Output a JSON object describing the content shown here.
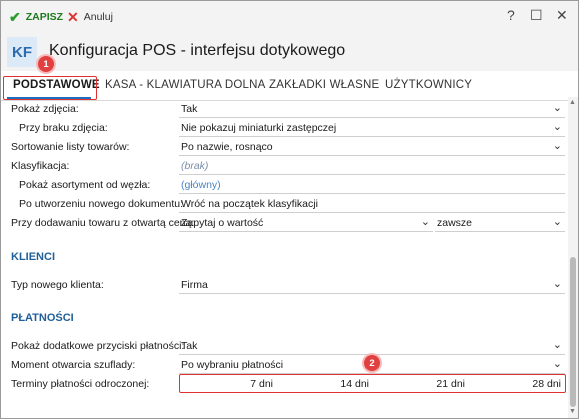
{
  "toolbar": {
    "save": "ZAPISZ",
    "cancel": "Anuluj"
  },
  "window_controls": {
    "help": "?",
    "minimize": "—",
    "maximize": "☐",
    "close": "✕"
  },
  "header": {
    "badge": "KF",
    "title": "Konfiguracja POS - interfejsu dotykowego"
  },
  "tabs": [
    {
      "label": "PODSTAWOWE",
      "active": true
    },
    {
      "label": "KASA - KLAWIATURA DOLNA"
    },
    {
      "label": "ZAKŁADKI WŁASNE"
    },
    {
      "label": "UŻYTKOWNICY"
    }
  ],
  "markers": {
    "m1": "1",
    "m2": "2"
  },
  "general": {
    "pokaz_zdjecia": {
      "label": "Pokaż zdjęcia:",
      "value": "Tak"
    },
    "przy_braku": {
      "label": "Przy braku zdjęcia:",
      "value": "Nie pokazuj miniaturki zastępczej"
    },
    "sortowanie": {
      "label": "Sortowanie listy towarów:",
      "value": "Po nazwie, rosnąco"
    },
    "klasyfikacja": {
      "label": "Klasyfikacja:",
      "value": "(brak)"
    },
    "pokaz_asort": {
      "label": "Pokaż asortyment od węzła:",
      "value": "(główny)"
    },
    "po_utworzeniu": {
      "label": "Po utworzeniu nowego dokumentu:",
      "value": "Wróć na początek klasyfikacji"
    },
    "przy_dodawaniu": {
      "label": "Przy dodawaniu towaru z otwartą ceną:",
      "value": "Zapytaj o wartość",
      "value2": "zawsze"
    }
  },
  "klienci": {
    "title": "KLIENCI",
    "typ": {
      "label": "Typ nowego klienta:",
      "value": "Firma"
    }
  },
  "platnosci": {
    "title": "PŁATNOŚCI",
    "pokaz_przyciski": {
      "label": "Pokaż dodatkowe przyciski płatności:",
      "value": "Tak"
    },
    "moment": {
      "label": "Moment otwarcia szuflady:",
      "value": "Po wybraniu płatności"
    },
    "terminy": {
      "label": "Terminy płatności odroczonej:",
      "values": [
        "7 dni",
        "14 dni",
        "21 dni",
        "28 dni"
      ]
    }
  },
  "colors": {
    "accent": "#1f6fbf",
    "highlight": "#e03030",
    "section": "#1f5f99",
    "save": "#1d7a1d"
  }
}
